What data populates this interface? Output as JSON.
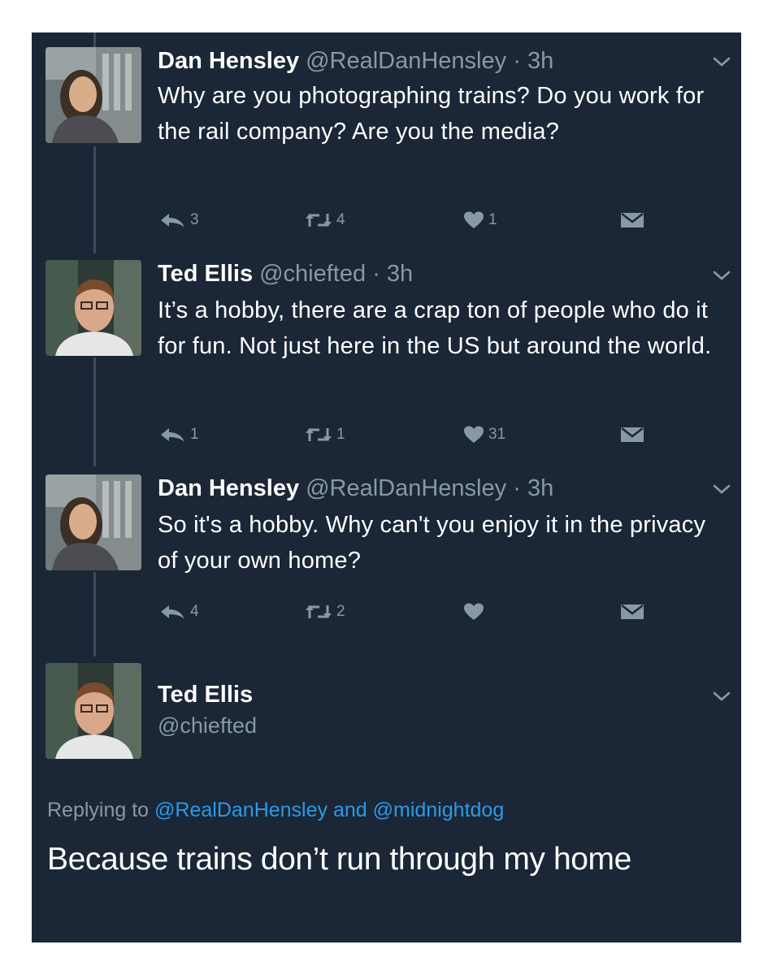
{
  "tweets": [
    {
      "name": "Dan Hensley",
      "handle": "@RealDanHensley",
      "separator": "·",
      "time": "3h",
      "text": "Why are you photographing trains? Do you work for the rail company? Are you the media?",
      "replies": "3",
      "retweets": "4",
      "likes": "1"
    },
    {
      "name": "Ted Ellis",
      "handle": "@chiefted",
      "separator": "·",
      "time": "3h",
      "text": "It’s a hobby, there are a crap ton of people who do it for fun. Not just here in the US but around the world.",
      "replies": "1",
      "retweets": "1",
      "likes": "31"
    },
    {
      "name": "Dan Hensley",
      "handle": "@RealDanHensley",
      "separator": "·",
      "time": "3h",
      "text": "So it's a hobby. Why can't you enjoy it in the privacy of your own home?",
      "replies": "4",
      "retweets": "2",
      "likes": ""
    }
  ],
  "focused_tweet": {
    "name": "Ted Ellis",
    "handle": "@chiefted",
    "replying_prefix": "Replying to",
    "replying_to_1": "@RealDanHensley",
    "replying_and": "and",
    "replying_to_2": "@midnightdog",
    "text": "Because trains don’t run through my home"
  },
  "icons": {
    "reply": "reply-arrow-icon",
    "retweet": "retweet-icon",
    "like": "heart-icon",
    "dm": "direct-message-icon",
    "more": "chevron-down-icon"
  },
  "colors": {
    "background": "#1b2636",
    "primary_text": "#ffffff",
    "secondary_text": "#8899a6",
    "link": "#2b9ae8",
    "thread_line": "#3d4a5c"
  }
}
